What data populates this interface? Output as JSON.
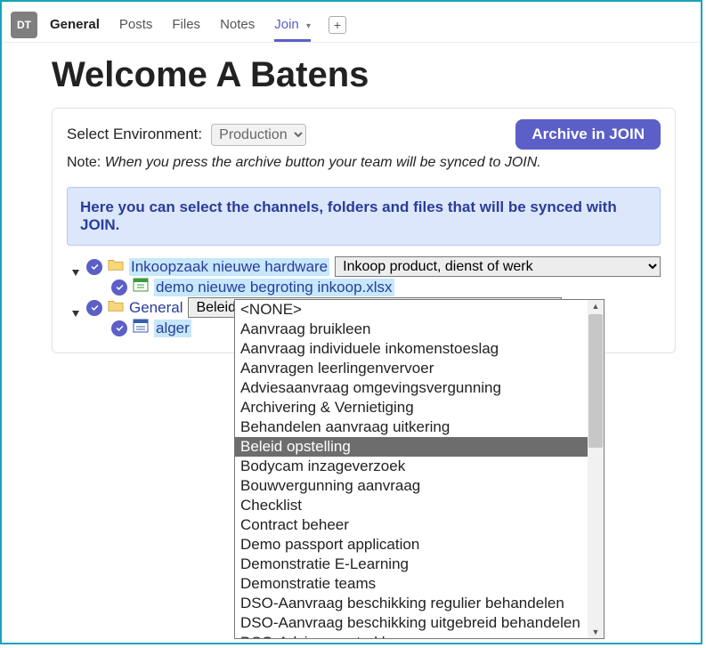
{
  "avatar": "DT",
  "tabs": {
    "general": "General",
    "posts": "Posts",
    "files": "Files",
    "notes": "Notes",
    "join": "Join"
  },
  "title": "Welcome A Batens",
  "selectEnvLabel": "Select Environment:",
  "envOptions": [
    "Production"
  ],
  "archiveBtn": "Archive in JOIN",
  "noteLabel": "Note:",
  "noteText": "When you press the archive button your team will be synced to JOIN.",
  "infoBox": "Here you can select the channels, folders and files that will be synced with JOIN.",
  "tree": {
    "node1": {
      "label": "Inkoopzaak nieuwe hardware",
      "select": "Inkoop product, dienst of werk",
      "child": "demo nieuwe begroting inkoop.xlsx"
    },
    "node2": {
      "label": "General",
      "select": "Beleid opstelling",
      "child": "alger"
    }
  },
  "dropdown": {
    "selected": "Beleid opstelling",
    "items": [
      "<NONE>",
      "Aanvraag bruikleen",
      "Aanvraag individuele inkomenstoeslag",
      "Aanvragen leerlingenvervoer",
      "Adviesaanvraag omgevingsvergunning",
      "Archivering & Vernietiging",
      "Behandelen aanvraag uitkering",
      "Beleid opstelling",
      "Bodycam inzageverzoek",
      "Bouwvergunning aanvraag",
      "Checklist",
      "Contract beheer",
      "Demo passport application",
      "Demonstratie E-Learning",
      "Demonstratie teams",
      "DSO-Aanvraag beschikking regulier behandelen",
      "DSO-Aanvraag beschikking uitgebreid behandelen",
      "DSO-Advies verstrekken"
    ]
  }
}
